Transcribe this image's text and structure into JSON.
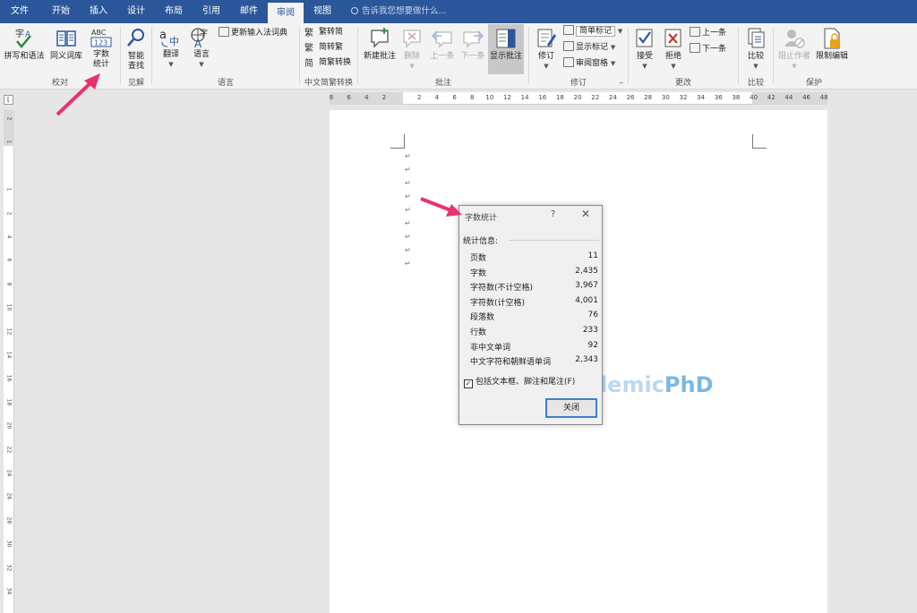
{
  "tabs": [
    {
      "label": "文件"
    },
    {
      "label": "开始"
    },
    {
      "label": "插入"
    },
    {
      "label": "设计"
    },
    {
      "label": "布局"
    },
    {
      "label": "引用"
    },
    {
      "label": "邮件"
    },
    {
      "label": "审阅"
    },
    {
      "label": "视图"
    }
  ],
  "active_tab": "审阅",
  "tell_me": "告诉我您想要做什么...",
  "ribbon": {
    "proofing": {
      "label": "校对",
      "spell": "拼写和语法",
      "thesaurus": "同义词库",
      "wordcount_line1": "字数",
      "wordcount_line2": "统计",
      "wordcount_icon_text": "ABC",
      "wordcount_icon_num": "123"
    },
    "insights": {
      "label": "见解",
      "smart_line1": "智能",
      "smart_line2": "查找"
    },
    "language": {
      "label": "语言",
      "translate": "翻译",
      "language": "语言",
      "update_ime": "更新输入法词典"
    },
    "chinese": {
      "label": "中文简繁转换",
      "t2s": "繁转简",
      "s2t": "简转繁",
      "convert": "简繁转换"
    },
    "comments": {
      "label": "批注",
      "new": "新建批注",
      "delete": "删除",
      "prev": "上一条",
      "next": "下一条",
      "show": "显示批注"
    },
    "tracking": {
      "label": "修订",
      "track": "修订",
      "markup": "简单标记",
      "show_markup": "显示标记",
      "pane": "审阅窗格"
    },
    "changes": {
      "label": "更改",
      "accept": "接受",
      "reject": "拒绝",
      "prev": "上一条",
      "next": "下一条"
    },
    "compare": {
      "label": "比较",
      "compare": "比较"
    },
    "protect": {
      "label": "保护",
      "block": "阻止作者",
      "restrict": "限制编辑"
    }
  },
  "ruler_top": [
    "8",
    "6",
    "4",
    "2",
    "",
    "2",
    "4",
    "6",
    "8",
    "10",
    "12",
    "14",
    "16",
    "18",
    "20",
    "22",
    "24",
    "26",
    "28",
    "30",
    "32",
    "34",
    "36",
    "38",
    "40",
    "42",
    "44",
    "46",
    "48"
  ],
  "ruler_left": [
    "2",
    "1",
    "",
    "1",
    "2",
    "4",
    "6",
    "8",
    "10",
    "12",
    "14",
    "16",
    "18",
    "20",
    "22",
    "24",
    "26",
    "28",
    "30",
    "32",
    "34"
  ],
  "paragraph_mark": "↵",
  "dialog": {
    "title": "字数统计",
    "help": "?",
    "close_x": "✕",
    "section": "统计信息:",
    "stats": [
      {
        "label": "页数",
        "value": "11"
      },
      {
        "label": "字数",
        "value": "2,435"
      },
      {
        "label": "字符数(不计空格)",
        "value": "3,967"
      },
      {
        "label": "字符数(计空格)",
        "value": "4,001"
      },
      {
        "label": "段落数",
        "value": "76"
      },
      {
        "label": "行数",
        "value": "233"
      },
      {
        "label": "非中文单词",
        "value": "92"
      },
      {
        "label": "中文字符和朝鲜语单词",
        "value": "2,343"
      }
    ],
    "checkbox_label": "包括文本框、脚注和尾注(F)",
    "checkbox_checked": true,
    "checkmark": "✓",
    "close_button": "关闭"
  },
  "watermark": {
    "part1": "Academic",
    "part2": "PhD"
  },
  "colors": {
    "title_bar": "#2b579a",
    "arrow": "#e8336b",
    "ribbon_bg": "#f3f3f3"
  }
}
